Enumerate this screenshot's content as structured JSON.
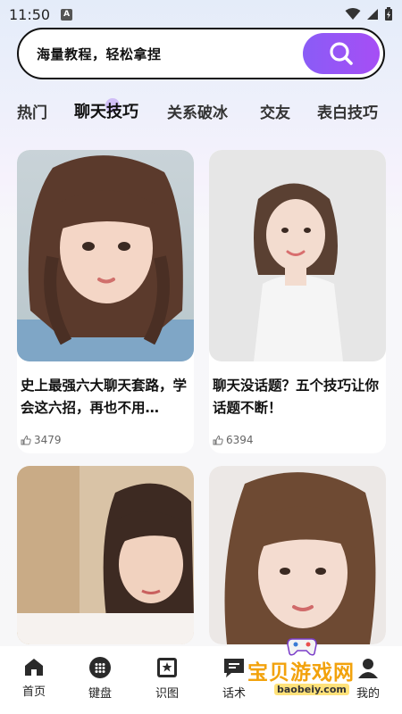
{
  "status_bar": {
    "time": "11:50",
    "notif_badge": "A"
  },
  "search": {
    "placeholder": "海量教程，轻松拿捏"
  },
  "tabs": [
    {
      "label": "热门"
    },
    {
      "label": "聊天技巧",
      "active": true
    },
    {
      "label": "关系破冰"
    },
    {
      "label": "交友"
    },
    {
      "label": "表白技巧"
    }
  ],
  "cards": [
    {
      "title": "史上最强六大聊天套路，学会这六招，再也不用…",
      "likes": "3479"
    },
    {
      "title": "聊天没话题？五个技巧让你话题不断！",
      "likes": "6394"
    },
    {
      "title": "",
      "likes": ""
    },
    {
      "title": "",
      "likes": ""
    }
  ],
  "nav": [
    {
      "label": "首页",
      "icon": "home-icon"
    },
    {
      "label": "键盘",
      "icon": "keyboard-icon"
    },
    {
      "label": "识图",
      "icon": "image-recognize-icon"
    },
    {
      "label": "话术",
      "icon": "chat-script-icon"
    },
    {
      "label": "我的",
      "icon": "profile-icon"
    }
  ],
  "watermark": {
    "text": "宝贝游戏网",
    "url": "baobeiy.com"
  },
  "colors": {
    "accent": "#9a55f5",
    "text": "#111111"
  }
}
